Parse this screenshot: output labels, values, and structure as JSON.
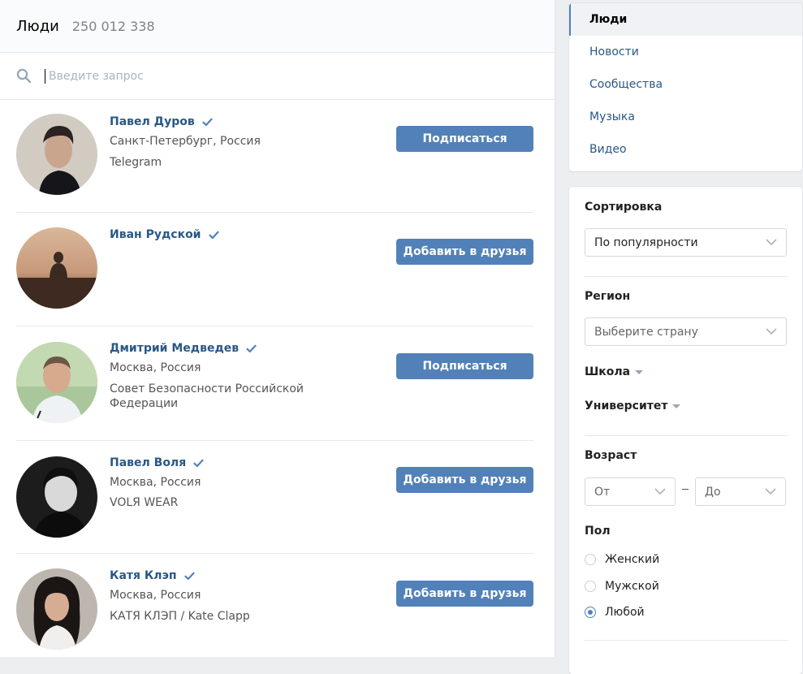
{
  "header": {
    "title": "Люди",
    "count": "250 012 338"
  },
  "search": {
    "placeholder": "Введите запрос",
    "value": ""
  },
  "people": [
    {
      "name": "Павел Дуров",
      "verified": true,
      "lines": [
        "Санкт-Петербург, Россия",
        "Telegram"
      ],
      "button": "Подписаться"
    },
    {
      "name": "Иван Рудской",
      "verified": true,
      "lines": [],
      "button": "Добавить в друзья"
    },
    {
      "name": "Дмитрий Медведев",
      "verified": true,
      "lines": [
        "Москва, Россия",
        "Совет Безопасности Российской",
        "Федерации"
      ],
      "button": "Подписаться"
    },
    {
      "name": "Павел Воля",
      "verified": true,
      "lines": [
        "Москва, Россия",
        "VOLЯ WEAR"
      ],
      "button": "Добавить в друзья"
    },
    {
      "name": "Катя Клэп",
      "verified": true,
      "lines": [
        "Москва, Россия",
        "КАТЯ КЛЭП / Kate Clapp"
      ],
      "button": "Добавить в друзья"
    }
  ],
  "menu": {
    "active": "Люди",
    "items": [
      "Люди",
      "Новости",
      "Сообщества",
      "Музыка",
      "Видео"
    ]
  },
  "filters": {
    "sort_label": "Сортировка",
    "sort_value": "По популярности",
    "region_label": "Регион",
    "region_placeholder": "Выберите страну",
    "school_label": "Школа",
    "university_label": "Университет",
    "age_label": "Возраст",
    "age_from": "От",
    "age_to": "До",
    "gender_label": "Пол",
    "gender_options": [
      "Женский",
      "Мужской",
      "Любой"
    ],
    "gender_selected": "Любой"
  },
  "colors": {
    "accent": "#5181b8",
    "link": "#2a5885",
    "page_bg": "#edeef0"
  },
  "icons": {
    "search": "search-icon",
    "verified": "verified-check-icon",
    "chevron": "chevron-down-icon"
  }
}
